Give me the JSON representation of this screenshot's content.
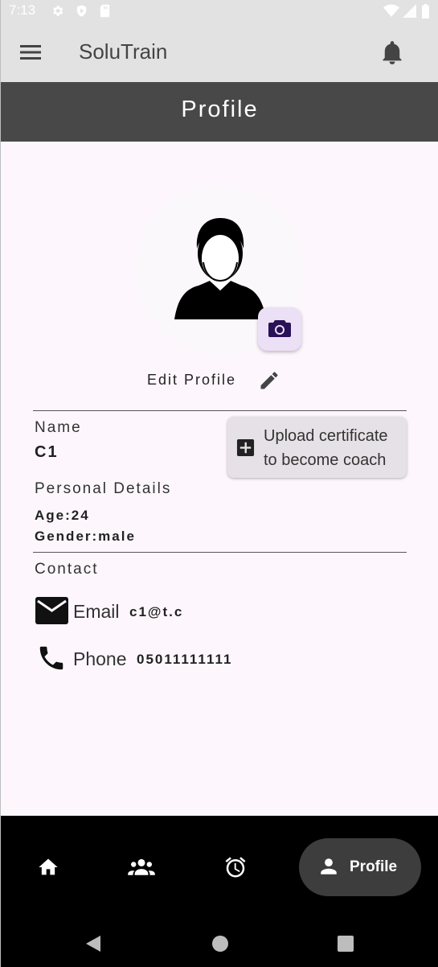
{
  "status_bar": {
    "time": "7:13"
  },
  "app_bar": {
    "title": "SoluTrain"
  },
  "page_header": {
    "title": "Profile"
  },
  "profile": {
    "edit_label": "Edit Profile",
    "name_label": "Name",
    "name_value": "C1",
    "personal_label": "Personal Details",
    "age_text": "Age:24",
    "gender_text": "Gender:male",
    "contact_label": "Contact",
    "email_key": "Email",
    "email_value": "c1@t.c",
    "phone_key": "Phone",
    "phone_value": "05011111111"
  },
  "upload_button": {
    "line1": "Upload certificate",
    "line2": "to become coach"
  },
  "bottom_nav": {
    "items": [
      {
        "icon": "home-icon"
      },
      {
        "icon": "group-icon"
      },
      {
        "icon": "alarm-icon"
      },
      {
        "icon": "person-icon",
        "label": "Profile",
        "active": true
      }
    ]
  },
  "colors": {
    "accent": "#3d3d3d",
    "header": "#484848",
    "camera_bg": "#ebe0f5",
    "camera_icon": "#2b1157"
  }
}
